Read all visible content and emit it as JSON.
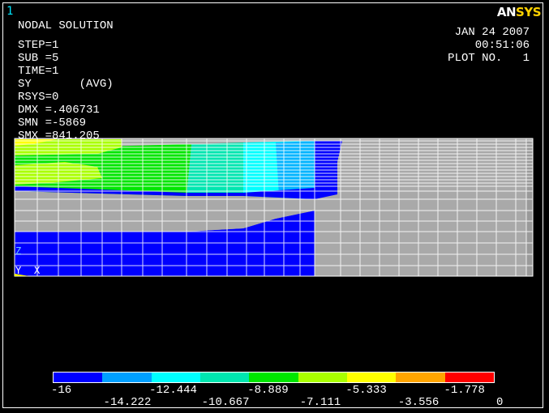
{
  "window": {
    "number": "1"
  },
  "logo": {
    "part1": "AN",
    "part2": "SYS"
  },
  "info": {
    "title": "NODAL SOLUTION",
    "step": "STEP=1",
    "sub": "SUB =5",
    "time": "TIME=1",
    "component": "SY       (AVG)",
    "rsys": "RSYS=0",
    "dmx": "DMX =.406731",
    "smn": "SMN =-5869",
    "smx": "SMX =841.205"
  },
  "header_right": {
    "date": "JAN 24 2007",
    "time": "00:51:06",
    "plot": "PLOT NO.   1"
  },
  "triad": {
    "z": "Z",
    "y": "Y",
    "x": "X"
  },
  "legend": {
    "colors": [
      "#0000ff",
      "#00a0ff",
      "#00ffff",
      "#00e6b0",
      "#00e600",
      "#aaff00",
      "#ffff00",
      "#ffa500",
      "#ff0000"
    ],
    "labels_top_row": [
      "-16",
      "-12.444",
      "-8.889",
      "-5.333",
      "-1.778"
    ],
    "labels_bottom_row": [
      "-14.222",
      "-10.667",
      "-7.111",
      "-3.556",
      "0"
    ]
  },
  "colors": {
    "mesh_gray": "#a9a9a9",
    "mesh_line": "#ffffff",
    "accent_logo": "#ffd200"
  }
}
